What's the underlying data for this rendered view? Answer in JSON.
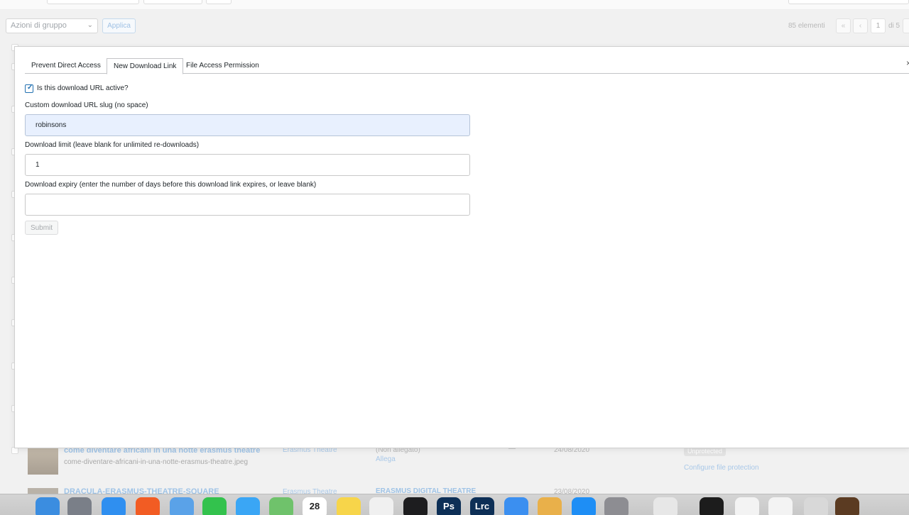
{
  "background": {
    "bulk_actions_placeholder": "Azioni di gruppo",
    "apply_label": "Applica",
    "item_count": "85 elementi",
    "pagination": {
      "first": "«",
      "prev": "‹",
      "current": "1",
      "of_total": "di 5"
    },
    "rows": [
      {
        "title": "come diventare africani in una notte erasmus theatre",
        "filename": "come-diventare-africani-in-una-notte-erasmus-theatre.jpeg",
        "author": "Erasmus Theatre",
        "attached": "(Non allegato)",
        "attach_link": "Allega",
        "comments": "—",
        "date": "24/08/2020",
        "status_badge": "Unprotected",
        "protect_link": "Configure file protection"
      },
      {
        "title": "DRACULA-ERASMUS-THEATRE-SQUARE",
        "author": "Erasmus Theatre",
        "attached": "ERASMUS DIGITAL THEATRE",
        "date": "23/08/2020"
      }
    ]
  },
  "modal": {
    "tabs": [
      {
        "label": "Prevent Direct Access",
        "active": false
      },
      {
        "label": "New Download Link",
        "active": true
      },
      {
        "label": "File Access Permission",
        "active": false
      }
    ],
    "active_checkbox_label": "Is this download URL active?",
    "active_checked": true,
    "slug_label": "Custom download URL slug (no space)",
    "slug_value": "robinsons",
    "limit_label": "Download limit (leave blank for unlimited re-downloads)",
    "limit_value": "1",
    "expiry_label": "Download expiry (enter the number of days before this download link expires, or leave blank)",
    "expiry_value": "",
    "submit_label": "Submit",
    "close_glyph": "×"
  },
  "dock": {
    "items": [
      {
        "name": "finder-icon",
        "color": "#3b8de0",
        "glyph": ""
      },
      {
        "name": "launchpad-icon",
        "color": "#7a7f88",
        "glyph": ""
      },
      {
        "name": "safari-icon",
        "color": "#2f8ff0",
        "glyph": ""
      },
      {
        "name": "brave-icon",
        "color": "#f25c23",
        "glyph": ""
      },
      {
        "name": "mail-icon",
        "color": "#5aa2e8",
        "glyph": ""
      },
      {
        "name": "facetime-icon",
        "color": "#33c24d",
        "glyph": ""
      },
      {
        "name": "messages-icon",
        "color": "#3aa6f5",
        "glyph": ""
      },
      {
        "name": "maps-icon",
        "color": "#6fc26b",
        "glyph": ""
      },
      {
        "name": "calendar-icon",
        "color": "#ffffff",
        "glyph": "28"
      },
      {
        "name": "notes-icon",
        "color": "#f7d54a",
        "glyph": ""
      },
      {
        "name": "music-icon",
        "color": "#f0f0f0",
        "glyph": ""
      },
      {
        "name": "downloader-icon",
        "color": "#1d1d1f",
        "glyph": ""
      },
      {
        "name": "photoshop-icon",
        "color": "#0d2f56",
        "glyph": "Ps"
      },
      {
        "name": "lightroom-icon",
        "color": "#0d2f56",
        "glyph": "Lrc"
      },
      {
        "name": "testflight-icon",
        "color": "#3b8ff0",
        "glyph": ""
      },
      {
        "name": "preview-icon",
        "color": "#e9b04a",
        "glyph": ""
      },
      {
        "name": "app-store-icon",
        "color": "#1e8ef5",
        "glyph": ""
      },
      {
        "name": "system-preferences-icon",
        "color": "#8d8d92",
        "glyph": ""
      },
      {
        "name": "chrome-icon",
        "color": "#e7e7e7",
        "glyph": ""
      },
      {
        "name": "terminal-icon",
        "color": "#1c1c1c",
        "glyph": ""
      },
      {
        "name": "window-thumb-1-icon",
        "color": "#f3f3f3",
        "glyph": ""
      },
      {
        "name": "window-thumb-2-icon",
        "color": "#f3f3f3",
        "glyph": ""
      },
      {
        "name": "trash-icon",
        "color": "#d8d8d8",
        "glyph": ""
      },
      {
        "name": "photo-thumb-icon",
        "color": "#5b3b22",
        "glyph": ""
      }
    ]
  }
}
